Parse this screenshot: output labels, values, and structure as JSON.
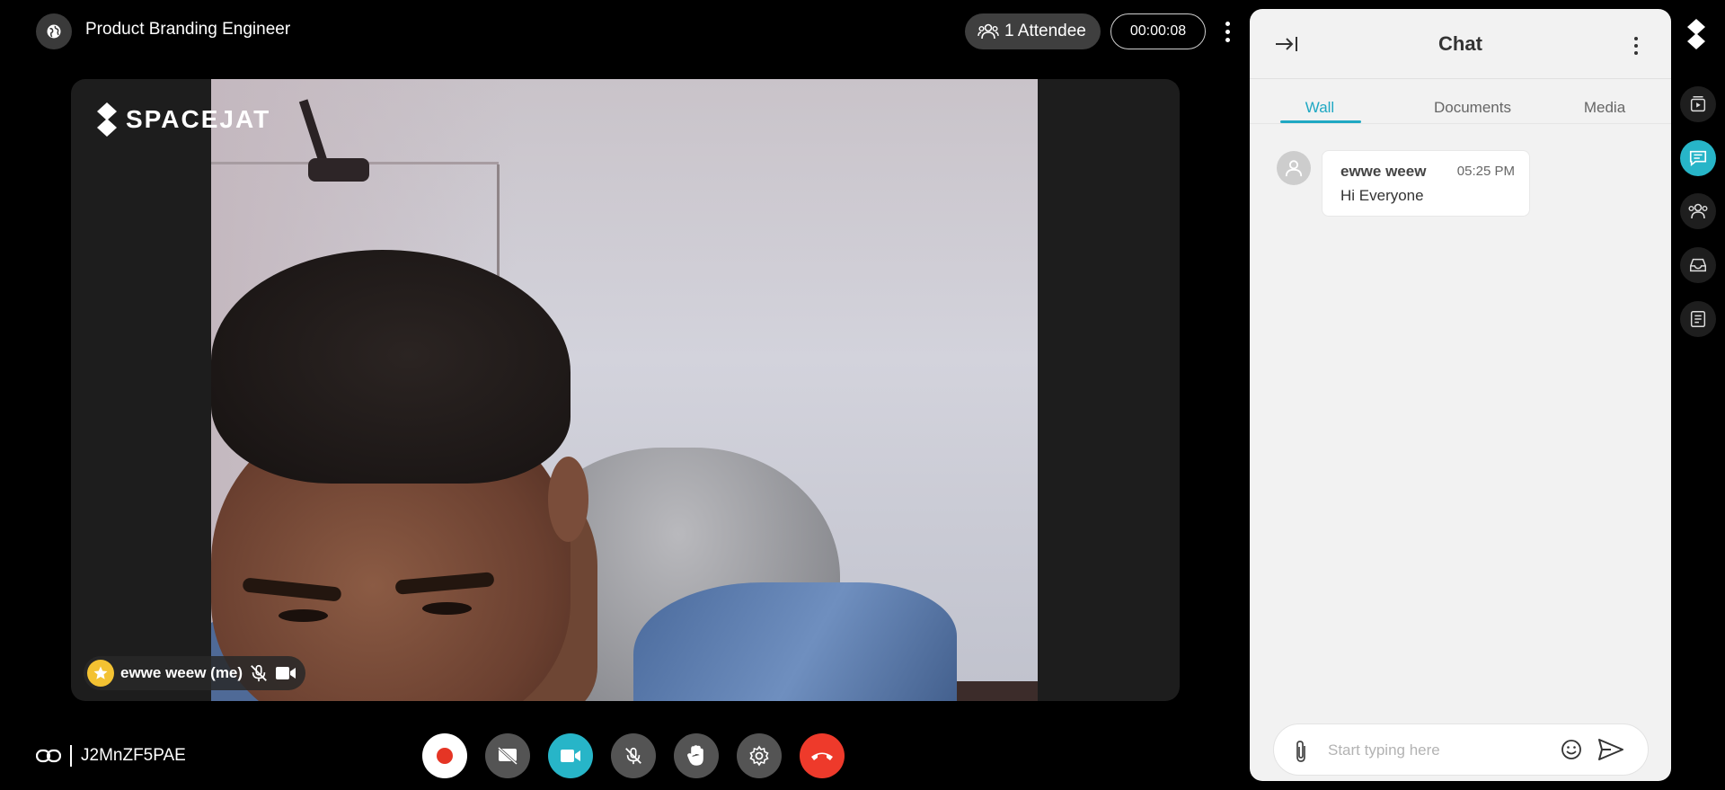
{
  "meeting": {
    "title": "Product Branding Engineer",
    "attendees": "1 Attendee",
    "timer": "00:00:08",
    "room_code": "J2MnZF5PAE"
  },
  "video": {
    "brand": "SPACEJAT",
    "participant_name": "ewwe weew (me)"
  },
  "chat": {
    "title": "Chat",
    "tabs": [
      "Wall",
      "Documents",
      "Media"
    ],
    "active_tab": "Wall",
    "messages": [
      {
        "author": "ewwe weew",
        "time": "05:25 PM",
        "text": "Hi Everyone"
      }
    ],
    "composer_placeholder": "Start typing here"
  },
  "colors": {
    "accent": "#27b5c8",
    "end_call": "#ee3a2b",
    "badge": "#f3c232"
  },
  "icons": {
    "controls": [
      "record-icon",
      "screen-share-off-icon",
      "camera-icon",
      "mic-off-icon",
      "raise-hand-icon",
      "settings-icon",
      "end-call-icon"
    ],
    "rail": [
      "spacejat-logo",
      "playlist-icon",
      "chat-icon",
      "participants-icon",
      "inbox-icon",
      "notes-icon"
    ]
  }
}
